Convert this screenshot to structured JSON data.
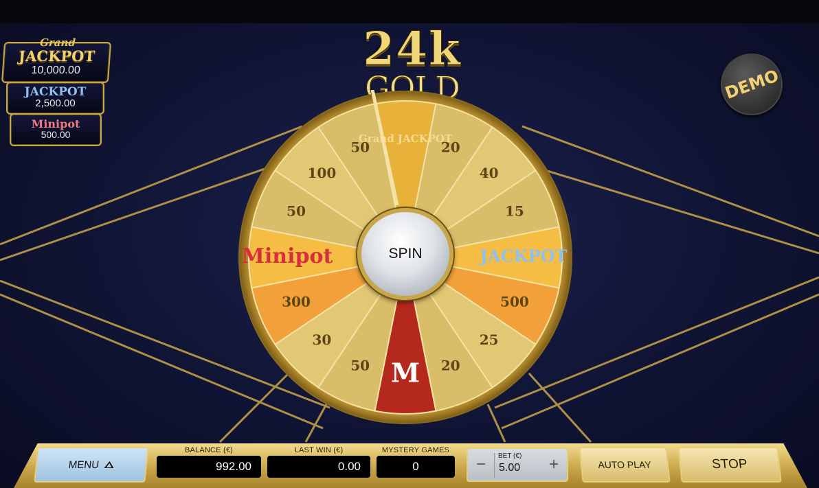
{
  "logo": {
    "line1": "24k",
    "line2": "GOLD WHEEL"
  },
  "demo_badge": "DEMO",
  "jackpots": {
    "grand": {
      "small": "Grand",
      "name": "JACKPOT",
      "value": "10,000.00"
    },
    "major": {
      "name": "JACKPOT",
      "value": "2,500.00"
    },
    "mini": {
      "name": "Minipot",
      "value": "500.00"
    }
  },
  "wheel": {
    "segments_clockwise_from_top": [
      "Grand JACKPOT",
      "20",
      "40",
      "15",
      "JACKPOT",
      "500",
      "25",
      "20",
      "M",
      "50",
      "30",
      "300",
      "Minipot",
      "50",
      "100",
      "50"
    ],
    "spin_label": "SPIN"
  },
  "bottom_bar": {
    "menu_label": "MENU",
    "balance_label": "BALANCE (€)",
    "balance_value": "992.00",
    "last_win_label": "LAST WIN (€)",
    "last_win_value": "0.00",
    "mystery_label": "MYSTERY GAMES",
    "mystery_value": "0",
    "bet_label": "BET (€)",
    "bet_value": "5.00",
    "minus": "−",
    "plus": "+",
    "auto_play_label": "AUTO PLAY",
    "stop_label": "STOP"
  },
  "colors": {
    "gold": "#c9a64a",
    "orange_segment": "#f2a03a",
    "red_segment": "#b5281e",
    "background": "#121638"
  }
}
